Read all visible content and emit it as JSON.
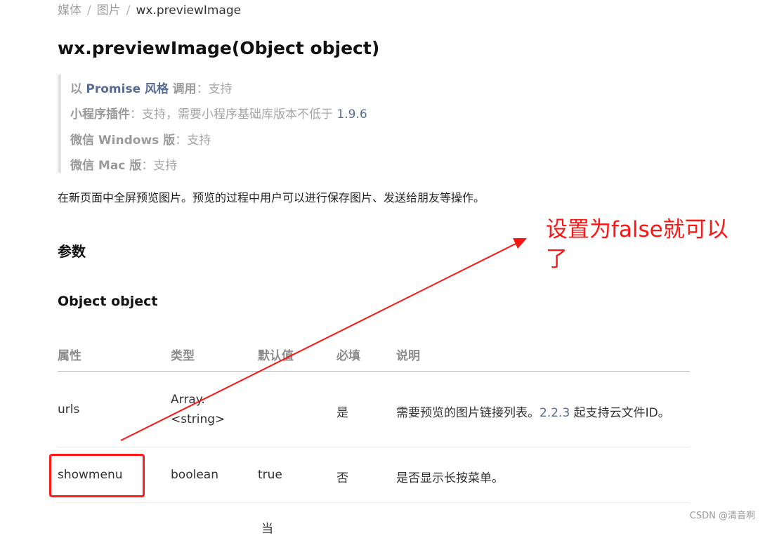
{
  "breadcrumb": {
    "item1": "媒体",
    "item2": "图片",
    "current": "wx.previewImage",
    "separator": "/"
  },
  "title": "wx.previewImage(Object object)",
  "support": {
    "line1": {
      "prefix": "以",
      "link": "Promise 风格",
      "suffix": "调用",
      "value": "：支持"
    },
    "line2": {
      "label": "小程序插件",
      "value": "：支持，需要小程序基础库版本不低于 ",
      "version": "1.9.6"
    },
    "line3": {
      "label": "微信 Windows 版",
      "value": "：支持"
    },
    "line4": {
      "label": "微信 Mac 版",
      "value": "：支持"
    }
  },
  "description": "在新页面中全屏预览图片。预览的过程中用户可以进行保存图片、发送给朋友等操作。",
  "params_heading": "参数",
  "object_heading": "Object object",
  "table": {
    "headers": [
      "属性",
      "类型",
      "默认值",
      "必填",
      "说明"
    ],
    "rows": [
      {
        "name": "urls",
        "type_line1": "Array.",
        "type_line2": "<string>",
        "default": "",
        "required": "是",
        "desc_before": "需要预览的图片链接列表。",
        "desc_version": "2.2.3",
        "desc_after": " 起支持云文件ID。"
      },
      {
        "name": "showmenu",
        "type_line1": "boolean",
        "default": "true",
        "required": "否",
        "desc_before": "是否显示长按菜单。"
      }
    ],
    "cut_row_text": "当"
  },
  "annotation": {
    "text": "设置为false就可以了",
    "color": "#ff1414"
  },
  "watermark": "CSDN @清音啊",
  "colors": {
    "link": "#576b95",
    "annotation": "#ff1414"
  }
}
